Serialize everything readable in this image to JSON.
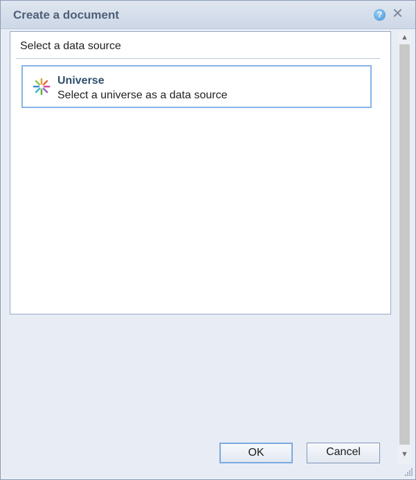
{
  "dialog": {
    "title": "Create a document",
    "help_icon": "help-icon",
    "close_icon": "close-icon"
  },
  "content": {
    "section_label": "Select a data source",
    "sources": [
      {
        "icon": "universe-icon",
        "title": "Universe",
        "description": "Select a universe as a data source"
      }
    ]
  },
  "footer": {
    "ok_label": "OK",
    "cancel_label": "Cancel"
  },
  "scrollbar": {
    "up_icon": "arrow-up-icon",
    "down_icon": "arrow-down-icon"
  },
  "colors": {
    "title_text": "#4f5f78",
    "selection_border": "#86b3e8",
    "universe_title": "#2e4f6d"
  }
}
